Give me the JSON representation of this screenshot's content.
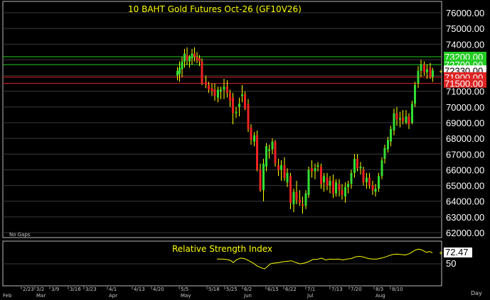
{
  "colors": {
    "background": "#000000",
    "grid": "#3a3a3a",
    "title": "#ffff00",
    "up_candle": "#33dd33",
    "down_candle": "#ee2222",
    "wick": "#ffff00",
    "rsi_line": "#ffff00",
    "green_level": "#22cc22",
    "red_level": "#dd2222",
    "last_price_box": "#ffffff"
  },
  "chart_data": [
    {
      "type": "candlestick",
      "title": "10 BAHT Gold Futures Oct-26 (GF10V26)",
      "ylim": [
        61800,
        76700
      ],
      "y_ticks": [
        "76000.00",
        "75000.00",
        "74000.00",
        "73000.00",
        "72000.00",
        "71000.00",
        "70000.00",
        "69000.00",
        "68000.00",
        "67000.00",
        "66000.00",
        "65000.00",
        "64000.00",
        "63000.00",
        "62000.00"
      ],
      "annotation": "No Gaps",
      "level_lines": [
        {
          "label": "73200.00",
          "value": 73200,
          "color": "green"
        },
        {
          "label": "72700.00",
          "value": 72700,
          "color": "green"
        },
        {
          "label": "72330.00",
          "value": 72330,
          "color": "white"
        },
        {
          "label": "71900.00",
          "value": 71900,
          "color": "red"
        },
        {
          "label": "71500.00",
          "value": 71500,
          "color": "red"
        }
      ],
      "candles": [
        {
          "x": 249.5,
          "o": 72000,
          "h": 72550,
          "l": 71700,
          "c": 72300
        },
        {
          "x": 252.5,
          "o": 72100,
          "h": 72900,
          "l": 71600,
          "c": 72500
        },
        {
          "x": 256.0,
          "o": 72400,
          "h": 73200,
          "l": 71900,
          "c": 72900
        },
        {
          "x": 259.5,
          "o": 72900,
          "h": 73700,
          "l": 72500,
          "c": 73400
        },
        {
          "x": 263.0,
          "o": 73300,
          "h": 73800,
          "l": 72700,
          "c": 73000
        },
        {
          "x": 266.5,
          "o": 72900,
          "h": 73300,
          "l": 72500,
          "c": 73200
        },
        {
          "x": 270.0,
          "o": 73100,
          "h": 73700,
          "l": 72700,
          "c": 73400
        },
        {
          "x": 273.5,
          "o": 73400,
          "h": 73800,
          "l": 72900,
          "c": 73200
        },
        {
          "x": 277.0,
          "o": 73200,
          "h": 73500,
          "l": 72800,
          "c": 73000
        },
        {
          "x": 280.5,
          "o": 73100,
          "h": 73300,
          "l": 72600,
          "c": 72900
        },
        {
          "x": 284.0,
          "o": 72900,
          "h": 73100,
          "l": 71400,
          "c": 71500
        },
        {
          "x": 289.5,
          "o": 71600,
          "h": 72000,
          "l": 71200,
          "c": 71400
        },
        {
          "x": 293.5,
          "o": 71400,
          "h": 71600,
          "l": 70900,
          "c": 71100
        },
        {
          "x": 298.0,
          "o": 71200,
          "h": 71500,
          "l": 70700,
          "c": 71000
        },
        {
          "x": 302.0,
          "o": 71100,
          "h": 71500,
          "l": 70400,
          "c": 70700
        },
        {
          "x": 306.5,
          "o": 70600,
          "h": 71300,
          "l": 70300,
          "c": 71100
        },
        {
          "x": 310.5,
          "o": 71000,
          "h": 71300,
          "l": 70500,
          "c": 71100
        },
        {
          "x": 315.0,
          "o": 71100,
          "h": 71800,
          "l": 70500,
          "c": 71300
        },
        {
          "x": 319.5,
          "o": 71300,
          "h": 71700,
          "l": 70600,
          "c": 70900
        },
        {
          "x": 323.5,
          "o": 70900,
          "h": 71100,
          "l": 70000,
          "c": 70400
        },
        {
          "x": 327.5,
          "o": 70600,
          "h": 70900,
          "l": 68900,
          "c": 69600
        },
        {
          "x": 332.0,
          "o": 69600,
          "h": 70000,
          "l": 69300,
          "c": 69700
        },
        {
          "x": 336.5,
          "o": 70000,
          "h": 70600,
          "l": 69400,
          "c": 70200
        },
        {
          "x": 340.5,
          "o": 70700,
          "h": 71400,
          "l": 70300,
          "c": 70800
        },
        {
          "x": 344.5,
          "o": 70800,
          "h": 71000,
          "l": 69800,
          "c": 69900
        },
        {
          "x": 349.0,
          "o": 70200,
          "h": 70500,
          "l": 68400,
          "c": 68600
        },
        {
          "x": 353.0,
          "o": 68700,
          "h": 68900,
          "l": 67600,
          "c": 67900
        },
        {
          "x": 357.5,
          "o": 67800,
          "h": 68400,
          "l": 67500,
          "c": 68200
        },
        {
          "x": 361.5,
          "o": 68200,
          "h": 68500,
          "l": 65900,
          "c": 66000
        },
        {
          "x": 366.0,
          "o": 66000,
          "h": 66400,
          "l": 64600,
          "c": 64700
        },
        {
          "x": 370.5,
          "o": 64700,
          "h": 66700,
          "l": 64000,
          "c": 66400
        },
        {
          "x": 374.5,
          "o": 66200,
          "h": 67700,
          "l": 65900,
          "c": 67500
        },
        {
          "x": 378.5,
          "o": 67200,
          "h": 67600,
          "l": 66700,
          "c": 67300
        },
        {
          "x": 383.0,
          "o": 67300,
          "h": 68000,
          "l": 67000,
          "c": 67800
        },
        {
          "x": 387.0,
          "o": 67800,
          "h": 67900,
          "l": 66200,
          "c": 66400
        },
        {
          "x": 391.5,
          "o": 66300,
          "h": 66700,
          "l": 65600,
          "c": 66000
        },
        {
          "x": 395.5,
          "o": 66000,
          "h": 66600,
          "l": 65300,
          "c": 66300
        },
        {
          "x": 400.0,
          "o": 66300,
          "h": 66800,
          "l": 65300,
          "c": 65500
        },
        {
          "x": 404.0,
          "o": 65200,
          "h": 66100,
          "l": 64900,
          "c": 65800
        },
        {
          "x": 408.5,
          "o": 65600,
          "h": 65800,
          "l": 63500,
          "c": 63900
        },
        {
          "x": 413.0,
          "o": 63800,
          "h": 64800,
          "l": 63300,
          "c": 64600
        },
        {
          "x": 417.0,
          "o": 64600,
          "h": 65300,
          "l": 63800,
          "c": 64100
        },
        {
          "x": 421.5,
          "o": 64100,
          "h": 64700,
          "l": 63700,
          "c": 63900
        },
        {
          "x": 425.5,
          "o": 63800,
          "h": 64300,
          "l": 63200,
          "c": 63700
        },
        {
          "x": 430.0,
          "o": 63700,
          "h": 64700,
          "l": 63500,
          "c": 64500
        },
        {
          "x": 434.0,
          "o": 64400,
          "h": 66200,
          "l": 64200,
          "c": 66000
        },
        {
          "x": 438.5,
          "o": 66100,
          "h": 66600,
          "l": 65500,
          "c": 65900
        },
        {
          "x": 443.0,
          "o": 65900,
          "h": 66400,
          "l": 65400,
          "c": 66100
        },
        {
          "x": 447.0,
          "o": 66200,
          "h": 66500,
          "l": 65900,
          "c": 66300
        },
        {
          "x": 451.5,
          "o": 66200,
          "h": 66400,
          "l": 64800,
          "c": 65100
        },
        {
          "x": 455.5,
          "o": 65200,
          "h": 65800,
          "l": 64600,
          "c": 65600
        },
        {
          "x": 460.0,
          "o": 65500,
          "h": 65800,
          "l": 64700,
          "c": 65000
        },
        {
          "x": 464.0,
          "o": 65000,
          "h": 65600,
          "l": 64500,
          "c": 65300
        },
        {
          "x": 468.5,
          "o": 65300,
          "h": 65700,
          "l": 64200,
          "c": 64500
        },
        {
          "x": 472.5,
          "o": 64500,
          "h": 65400,
          "l": 64300,
          "c": 65200
        },
        {
          "x": 477.0,
          "o": 65100,
          "h": 65400,
          "l": 64300,
          "c": 64700
        },
        {
          "x": 481.0,
          "o": 64700,
          "h": 65100,
          "l": 64100,
          "c": 64400
        },
        {
          "x": 485.5,
          "o": 64300,
          "h": 65200,
          "l": 63900,
          "c": 64900
        },
        {
          "x": 489.5,
          "o": 64900,
          "h": 65300,
          "l": 64500,
          "c": 65100
        },
        {
          "x": 494.0,
          "o": 65100,
          "h": 66000,
          "l": 64800,
          "c": 65800
        },
        {
          "x": 498.5,
          "o": 65800,
          "h": 67000,
          "l": 65500,
          "c": 66700
        },
        {
          "x": 502.5,
          "o": 66700,
          "h": 67000,
          "l": 65900,
          "c": 66100
        },
        {
          "x": 507.0,
          "o": 66100,
          "h": 66500,
          "l": 65700,
          "c": 66200
        },
        {
          "x": 511.0,
          "o": 66000,
          "h": 66200,
          "l": 65000,
          "c": 65200
        },
        {
          "x": 515.5,
          "o": 65200,
          "h": 65800,
          "l": 64800,
          "c": 65500
        },
        {
          "x": 519.5,
          "o": 65500,
          "h": 65800,
          "l": 64800,
          "c": 65000
        },
        {
          "x": 524.0,
          "o": 65000,
          "h": 65300,
          "l": 64400,
          "c": 64700
        },
        {
          "x": 528.0,
          "o": 64600,
          "h": 65100,
          "l": 64300,
          "c": 64800
        },
        {
          "x": 532.5,
          "o": 64800,
          "h": 65800,
          "l": 64600,
          "c": 65600
        },
        {
          "x": 537.0,
          "o": 65600,
          "h": 66800,
          "l": 65400,
          "c": 66600
        },
        {
          "x": 541.0,
          "o": 66700,
          "h": 67600,
          "l": 66400,
          "c": 67400
        },
        {
          "x": 545.5,
          "o": 67300,
          "h": 68100,
          "l": 67100,
          "c": 67900
        },
        {
          "x": 549.5,
          "o": 67800,
          "h": 68800,
          "l": 67500,
          "c": 68600
        },
        {
          "x": 554.0,
          "o": 68500,
          "h": 69900,
          "l": 68200,
          "c": 69600
        },
        {
          "x": 558.0,
          "o": 69600,
          "h": 70000,
          "l": 68800,
          "c": 69200
        },
        {
          "x": 562.5,
          "o": 69200,
          "h": 69700,
          "l": 68700,
          "c": 69300
        },
        {
          "x": 566.5,
          "o": 69300,
          "h": 69800,
          "l": 68900,
          "c": 69100
        },
        {
          "x": 571.0,
          "o": 69000,
          "h": 69800,
          "l": 68900,
          "c": 69400
        },
        {
          "x": 575.0,
          "o": 69400,
          "h": 69600,
          "l": 68600,
          "c": 68900
        },
        {
          "x": 579.5,
          "o": 69000,
          "h": 70400,
          "l": 68900,
          "c": 70200
        },
        {
          "x": 583.5,
          "o": 70200,
          "h": 71600,
          "l": 70000,
          "c": 71400
        },
        {
          "x": 588.0,
          "o": 71500,
          "h": 72600,
          "l": 71200,
          "c": 72300
        },
        {
          "x": 592.0,
          "o": 72300,
          "h": 73000,
          "l": 71900,
          "c": 72700
        },
        {
          "x": 596.5,
          "o": 72700,
          "h": 72900,
          "l": 72000,
          "c": 72200
        },
        {
          "x": 600.5,
          "o": 72200,
          "h": 72700,
          "l": 71800,
          "c": 72400
        },
        {
          "x": 605.0,
          "o": 72500,
          "h": 72800,
          "l": 71800,
          "c": 71900
        },
        {
          "x": 608.5,
          "o": 71900,
          "h": 72500,
          "l": 71600,
          "c": 72330
        }
      ]
    },
    {
      "type": "line",
      "title": "Relative Strength Index",
      "y_ticks": [
        "50"
      ],
      "last_value_label": "72.47",
      "ylim": [
        0,
        100
      ],
      "series": [
        {
          "x": [
            305,
            312,
            318,
            324,
            328,
            332,
            338,
            344,
            350,
            356,
            362,
            368,
            372,
            376,
            380,
            386,
            392,
            398,
            404,
            410,
            416,
            422,
            428,
            434,
            440,
            446,
            452,
            458,
            464,
            470,
            476,
            482,
            488,
            494,
            500,
            506,
            512,
            518,
            524,
            530,
            536,
            541,
            546,
            552,
            558,
            564,
            570,
            576,
            580,
            584,
            588,
            592,
            596,
            600,
            604,
            608
          ],
          "y": [
            60,
            60,
            59,
            57,
            52,
            58,
            62,
            61,
            56,
            51,
            44,
            40,
            38,
            43,
            49,
            51,
            52,
            54,
            55,
            56,
            52,
            49,
            51,
            54,
            59,
            59,
            62,
            58,
            60,
            59,
            60,
            58,
            60,
            61,
            65,
            66,
            64,
            61,
            60,
            60,
            62,
            64,
            67,
            70,
            71,
            70,
            69,
            72,
            76,
            80,
            82,
            81,
            78,
            75,
            77,
            74
          ]
        }
      ]
    }
  ],
  "x_axis": {
    "ticks": [
      "2/23",
      "3/2",
      "3/9",
      "3/16",
      "3/23",
      "4/1",
      "4/13",
      "4/20",
      "5/5",
      "5/18",
      "5/25",
      "6/2",
      "6/15",
      "6/22",
      "7/1",
      "7/13",
      "7/20",
      "8/3",
      "8/10"
    ],
    "months": [
      "Feb",
      "Mar",
      "Apr",
      "May",
      "Jun",
      "Jul",
      "Aug"
    ],
    "interval_label": "Day"
  }
}
